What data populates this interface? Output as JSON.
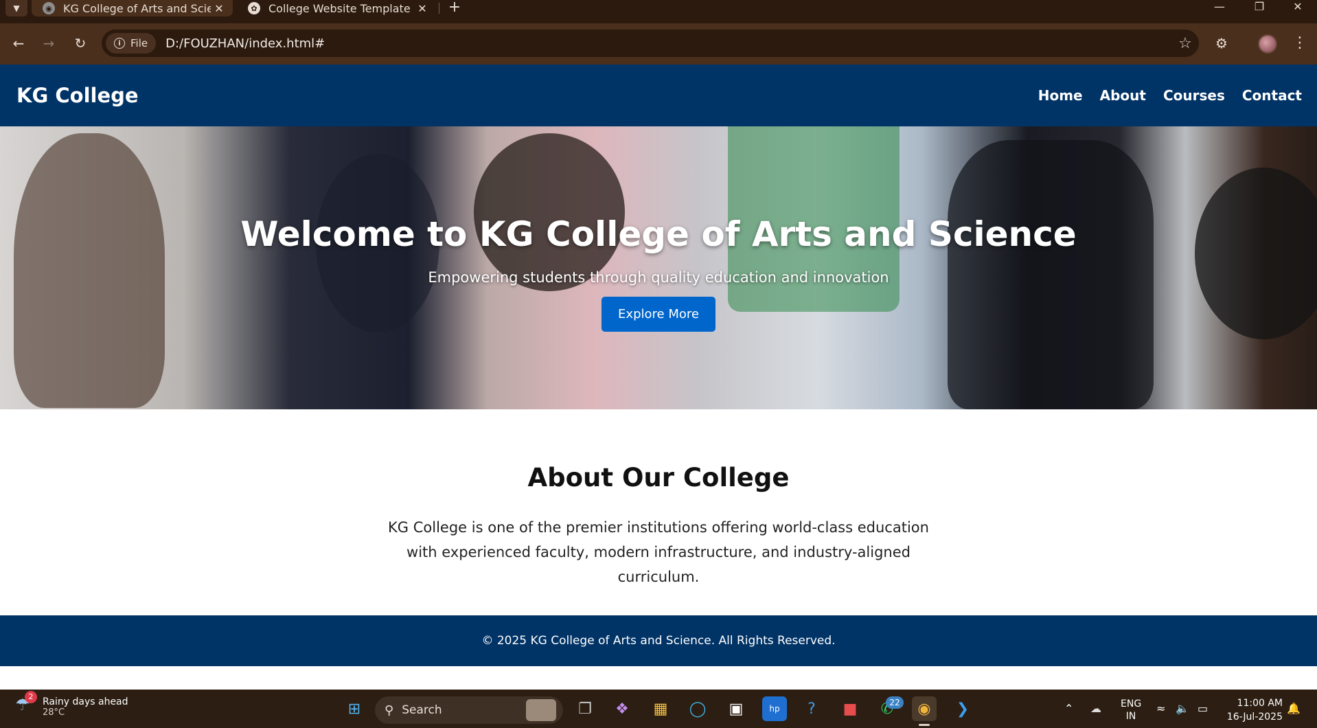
{
  "browser": {
    "tabs": [
      {
        "title": "KG College of Arts and Science",
        "active": true
      },
      {
        "title": "College Website Template",
        "active": false
      }
    ],
    "new_tab_symbol": "+",
    "site_chip_label": "File",
    "url": "D:/FOUZHAN/index.html#"
  },
  "site": {
    "logo": "KG College",
    "nav": [
      "Home",
      "About",
      "Courses",
      "Contact"
    ],
    "hero": {
      "title": "Welcome to KG College of Arts and Science",
      "subtitle": "Empowering students through quality education and innovation",
      "button": "Explore More"
    },
    "about": {
      "title": "About Our College",
      "text": "KG College is one of the premier institutions offering world-class education with experienced faculty, modern infrastructure, and industry-aligned curriculum."
    },
    "footer": "© 2025 KG College of Arts and Science. All Rights Reserved.",
    "colors": {
      "header_bg": "#003366",
      "button_bg": "#0066cc",
      "footer_bg": "#003366"
    }
  },
  "taskbar": {
    "weather": {
      "badge": "2",
      "headline": "Rainy days ahead",
      "temp": "28°C"
    },
    "search_label": "Search",
    "whatsapp_badge": "22",
    "language": {
      "line1": "ENG",
      "line2": "IN"
    },
    "clock": {
      "time": "11:00 AM",
      "date": "16-Jul-2025"
    }
  },
  "icons": [
    "tab-list-icon",
    "globe-icon",
    "openai-icon",
    "close-icon",
    "back-arrow-icon",
    "forward-arrow-icon",
    "reload-icon",
    "info-icon",
    "star-icon",
    "extensions-icon",
    "profile-avatar",
    "more-menu-icon",
    "windows-start-icon",
    "search-icon",
    "task-view-icon",
    "copilot-icon",
    "file-explorer-icon",
    "edge-icon",
    "store-icon",
    "myhp-icon",
    "help-icon",
    "whatsapp-icon",
    "chrome-icon",
    "vscode-icon",
    "chevron-up-icon",
    "onedrive-icon",
    "wifi-icon",
    "volume-icon",
    "battery-icon",
    "notification-bell-icon"
  ]
}
